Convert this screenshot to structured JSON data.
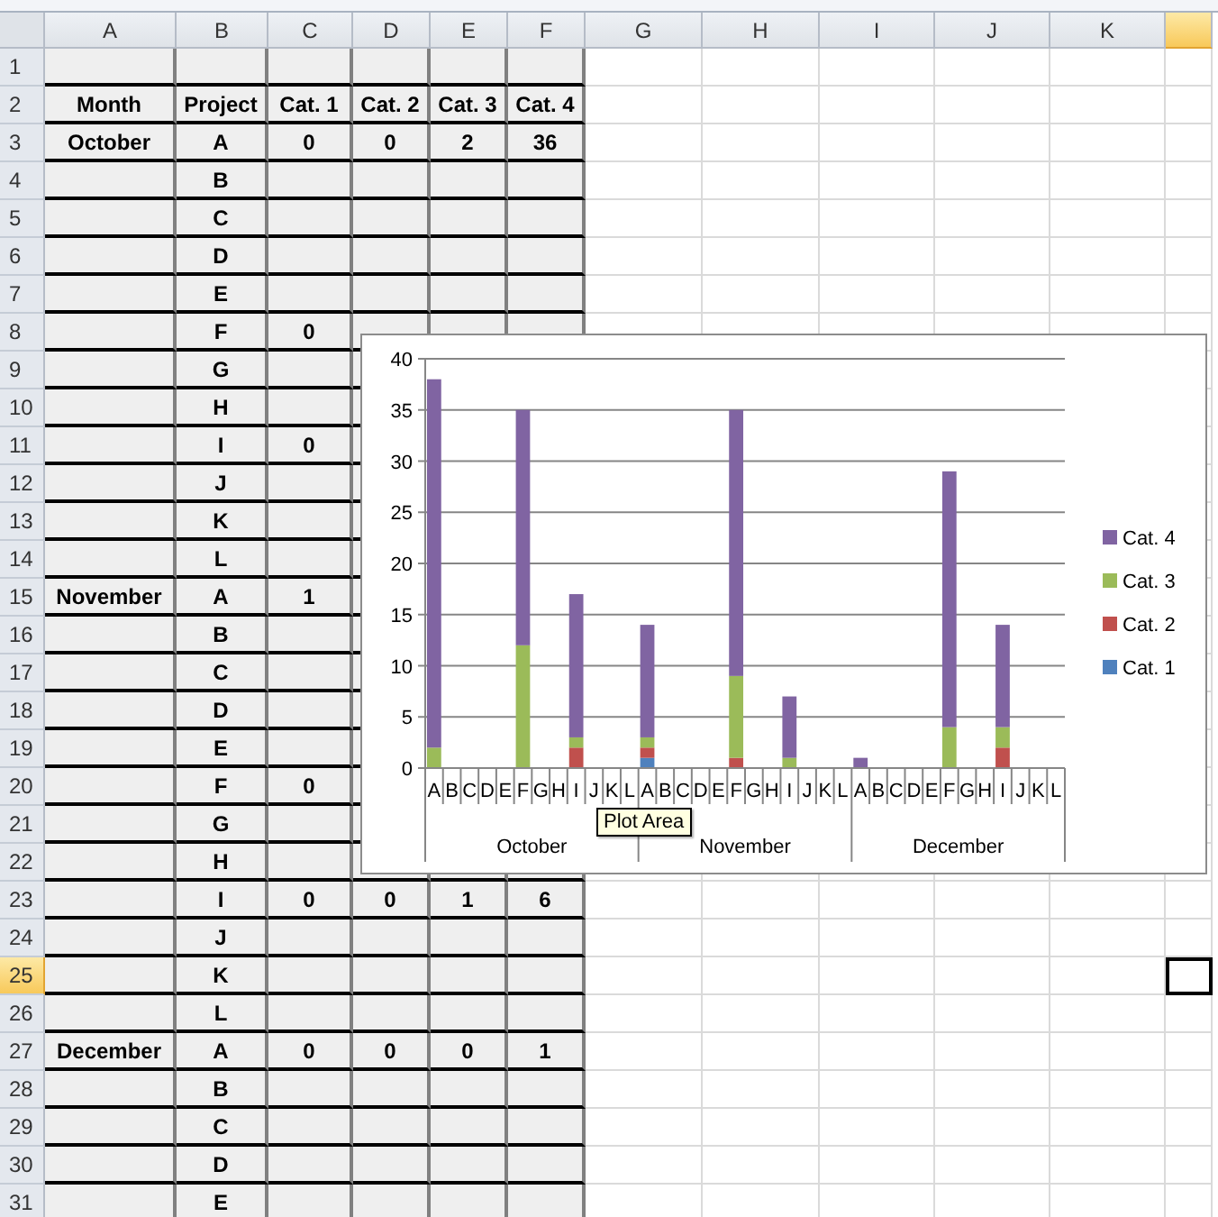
{
  "sheet": {
    "columns": [
      {
        "label": "A",
        "selected": false
      },
      {
        "label": "B",
        "selected": false
      },
      {
        "label": "C",
        "selected": false
      },
      {
        "label": "D",
        "selected": false
      },
      {
        "label": "E",
        "selected": false
      },
      {
        "label": "F",
        "selected": false
      },
      {
        "label": "G",
        "selected": false
      },
      {
        "label": "H",
        "selected": false
      },
      {
        "label": "I",
        "selected": false
      },
      {
        "label": "J",
        "selected": false
      },
      {
        "label": "K",
        "selected": false
      },
      {
        "selected": true
      }
    ],
    "rows": [
      {
        "number": "1",
        "selected": false
      },
      {
        "number": "2",
        "selected": false,
        "cells": {
          "a": "Month",
          "b": "Project",
          "c": "Cat. 1",
          "d": "Cat. 2",
          "e": "Cat. 3",
          "f": "Cat. 4"
        }
      },
      {
        "number": "3",
        "selected": false,
        "cells": {
          "a": "October",
          "b": "A",
          "c": "0",
          "d": "0",
          "e": "2",
          "f": "36"
        }
      },
      {
        "number": "4",
        "selected": false,
        "cells": {
          "b": "B"
        }
      },
      {
        "number": "5",
        "selected": false,
        "cells": {
          "b": "C"
        }
      },
      {
        "number": "6",
        "selected": false,
        "cells": {
          "b": "D"
        }
      },
      {
        "number": "7",
        "selected": false,
        "cells": {
          "b": "E"
        }
      },
      {
        "number": "8",
        "selected": false,
        "cells": {
          "b": "F",
          "c": "0"
        }
      },
      {
        "number": "9",
        "selected": false,
        "cells": {
          "b": "G"
        }
      },
      {
        "number": "10",
        "selected": false,
        "cells": {
          "b": "H"
        }
      },
      {
        "number": "11",
        "selected": false,
        "cells": {
          "b": "I",
          "c": "0"
        }
      },
      {
        "number": "12",
        "selected": false,
        "cells": {
          "b": "J"
        }
      },
      {
        "number": "13",
        "selected": false,
        "cells": {
          "b": "K"
        }
      },
      {
        "number": "14",
        "selected": false,
        "cells": {
          "b": "L"
        }
      },
      {
        "number": "15",
        "selected": false,
        "cells": {
          "a": "November",
          "b": "A",
          "c": "1"
        }
      },
      {
        "number": "16",
        "selected": false,
        "cells": {
          "b": "B"
        }
      },
      {
        "number": "17",
        "selected": false,
        "cells": {
          "b": "C"
        }
      },
      {
        "number": "18",
        "selected": false,
        "cells": {
          "b": "D"
        }
      },
      {
        "number": "19",
        "selected": false,
        "cells": {
          "b": "E"
        }
      },
      {
        "number": "20",
        "selected": false,
        "cells": {
          "b": "F",
          "c": "0"
        }
      },
      {
        "number": "21",
        "selected": false,
        "cells": {
          "b": "G"
        }
      },
      {
        "number": "22",
        "selected": false,
        "cells": {
          "b": "H"
        }
      },
      {
        "number": "23",
        "selected": false,
        "cells": {
          "b": "I",
          "c": "0",
          "d": "0",
          "e": "1",
          "f": "6"
        }
      },
      {
        "number": "24",
        "selected": false,
        "cells": {
          "b": "J"
        }
      },
      {
        "number": "25",
        "selected": true,
        "cells": {
          "b": "K"
        }
      },
      {
        "number": "26",
        "selected": false,
        "cells": {
          "b": "L"
        }
      },
      {
        "number": "27",
        "selected": false,
        "cells": {
          "a": "December",
          "b": "A",
          "c": "0",
          "d": "0",
          "e": "0",
          "f": "1"
        }
      },
      {
        "number": "28",
        "selected": false,
        "cells": {
          "b": "B"
        }
      },
      {
        "number": "29",
        "selected": false,
        "cells": {
          "b": "C"
        }
      },
      {
        "number": "30",
        "selected": false,
        "cells": {
          "b": "D"
        }
      },
      {
        "number": "31",
        "selected": false,
        "cells": {
          "b": "E"
        }
      }
    ]
  },
  "chart": {
    "tooltip": "Plot Area",
    "axis_groups": [
      "October",
      "November",
      "December"
    ],
    "chart_data": {
      "type": "bar",
      "stacked": true,
      "grid": true,
      "legend": true,
      "orientation": "vertical",
      "ylim": [
        0,
        40
      ],
      "yticks": [
        0,
        5,
        10,
        15,
        20,
        25,
        30,
        35,
        40
      ],
      "categories": [
        "A",
        "B",
        "C",
        "D",
        "E",
        "F",
        "G",
        "H",
        "I",
        "J",
        "K",
        "L",
        "A",
        "B",
        "C",
        "D",
        "E",
        "F",
        "G",
        "H",
        "I",
        "J",
        "K",
        "L",
        "A",
        "B",
        "C",
        "D",
        "E",
        "F",
        "G",
        "H",
        "I",
        "J",
        "K",
        "L"
      ],
      "series": [
        {
          "name": "Cat. 1",
          "color": "#4f81bd",
          "values": [
            0,
            null,
            null,
            null,
            null,
            0,
            null,
            null,
            0,
            null,
            null,
            null,
            1,
            null,
            null,
            null,
            null,
            0,
            null,
            null,
            0,
            null,
            null,
            null,
            0,
            null,
            null,
            null,
            null,
            0,
            null,
            null,
            0,
            null,
            null,
            null
          ]
        },
        {
          "name": "Cat. 2",
          "color": "#c0504d",
          "values": [
            0,
            null,
            null,
            null,
            null,
            0,
            null,
            null,
            2,
            null,
            null,
            null,
            1,
            null,
            null,
            null,
            null,
            1,
            null,
            null,
            0,
            null,
            null,
            null,
            0,
            null,
            null,
            null,
            null,
            0,
            null,
            null,
            2,
            null,
            null,
            null
          ]
        },
        {
          "name": "Cat. 3",
          "color": "#9bbb59",
          "values": [
            2,
            null,
            null,
            null,
            null,
            12,
            null,
            null,
            1,
            null,
            null,
            null,
            1,
            null,
            null,
            null,
            null,
            8,
            null,
            null,
            1,
            null,
            null,
            null,
            0,
            null,
            null,
            null,
            null,
            4,
            null,
            null,
            2,
            null,
            null,
            null
          ]
        },
        {
          "name": "Cat. 4",
          "color": "#8064a2",
          "values": [
            36,
            null,
            null,
            null,
            null,
            23,
            null,
            null,
            14,
            null,
            null,
            null,
            11,
            null,
            null,
            null,
            null,
            26,
            null,
            null,
            6,
            null,
            null,
            null,
            1,
            null,
            null,
            null,
            null,
            25,
            null,
            null,
            10,
            null,
            null,
            null
          ]
        }
      ]
    }
  }
}
